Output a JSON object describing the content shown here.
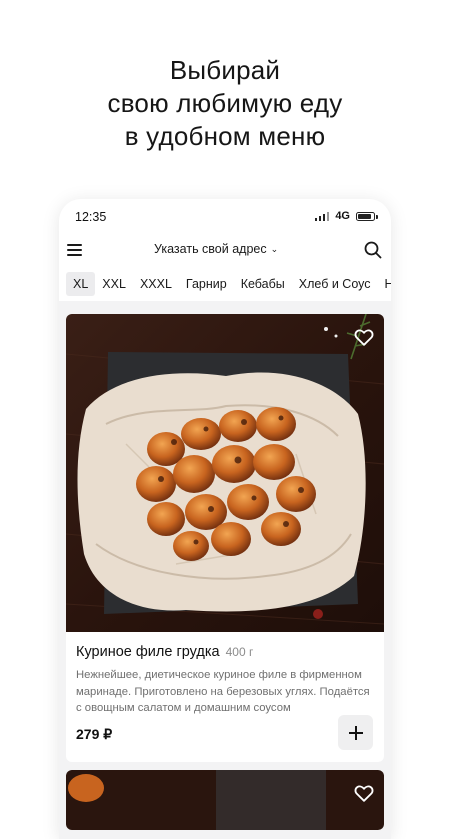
{
  "headline": {
    "line1": "Выбирай",
    "line2": "свою любимую еду",
    "line3": "в удобном меню"
  },
  "status": {
    "time": "12:35",
    "network": "4G"
  },
  "appbar": {
    "address": "Указать свой адрес",
    "chevron": "›"
  },
  "tabs": [
    {
      "label": "XL",
      "active": true
    },
    {
      "label": "XXL"
    },
    {
      "label": "XXXL"
    },
    {
      "label": "Гарнир"
    },
    {
      "label": "Кебабы"
    },
    {
      "label": "Хлеб и Соус"
    },
    {
      "label": "Н"
    }
  ],
  "product": {
    "title": "Куриное филе грудка",
    "weight": "400 г",
    "description": "Нежнейшее, диетическое куриное филе в фирменном маринаде. Приготовлено на березовых углях. Подаётся с овощным салатом и домашним соусом",
    "price": "279 ₽"
  },
  "icons": {
    "menu": "menu-icon",
    "search": "search-icon",
    "favorite": "heart-icon",
    "add": "plus-icon"
  },
  "colors": {
    "accent": "#111111",
    "background": "#ffffff",
    "surface": "#f3f3f4",
    "muted_text": "#707070"
  }
}
